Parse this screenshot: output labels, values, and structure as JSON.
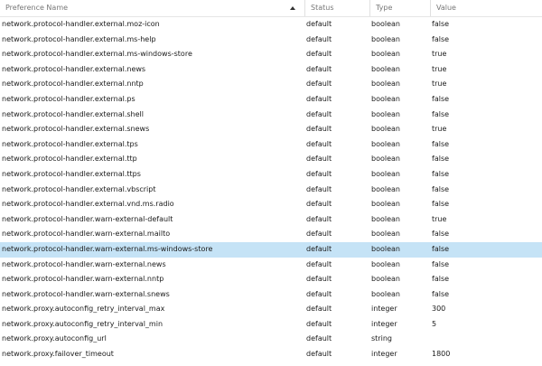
{
  "columns": {
    "name": "Preference Name",
    "status": "Status",
    "type": "Type",
    "value": "Value"
  },
  "sort": {
    "column": "name",
    "direction": "ascending",
    "icon": "sort-ascending-icon"
  },
  "colors": {
    "selected_row": "#c5e3f6"
  },
  "selected_index": 15,
  "rows": [
    {
      "name": "network.protocol-handler.external.moz-icon",
      "status": "default",
      "type": "boolean",
      "value": "false"
    },
    {
      "name": "network.protocol-handler.external.ms-help",
      "status": "default",
      "type": "boolean",
      "value": "false"
    },
    {
      "name": "network.protocol-handler.external.ms-windows-store",
      "status": "default",
      "type": "boolean",
      "value": "true"
    },
    {
      "name": "network.protocol-handler.external.news",
      "status": "default",
      "type": "boolean",
      "value": "true"
    },
    {
      "name": "network.protocol-handler.external.nntp",
      "status": "default",
      "type": "boolean",
      "value": "true"
    },
    {
      "name": "network.protocol-handler.external.ps",
      "status": "default",
      "type": "boolean",
      "value": "false"
    },
    {
      "name": "network.protocol-handler.external.shell",
      "status": "default",
      "type": "boolean",
      "value": "false"
    },
    {
      "name": "network.protocol-handler.external.snews",
      "status": "default",
      "type": "boolean",
      "value": "true"
    },
    {
      "name": "network.protocol-handler.external.tps",
      "status": "default",
      "type": "boolean",
      "value": "false"
    },
    {
      "name": "network.protocol-handler.external.ttp",
      "status": "default",
      "type": "boolean",
      "value": "false"
    },
    {
      "name": "network.protocol-handler.external.ttps",
      "status": "default",
      "type": "boolean",
      "value": "false"
    },
    {
      "name": "network.protocol-handler.external.vbscript",
      "status": "default",
      "type": "boolean",
      "value": "false"
    },
    {
      "name": "network.protocol-handler.external.vnd.ms.radio",
      "status": "default",
      "type": "boolean",
      "value": "false"
    },
    {
      "name": "network.protocol-handler.warn-external-default",
      "status": "default",
      "type": "boolean",
      "value": "true"
    },
    {
      "name": "network.protocol-handler.warn-external.mailto",
      "status": "default",
      "type": "boolean",
      "value": "false"
    },
    {
      "name": "network.protocol-handler.warn-external.ms-windows-store",
      "status": "default",
      "type": "boolean",
      "value": "false"
    },
    {
      "name": "network.protocol-handler.warn-external.news",
      "status": "default",
      "type": "boolean",
      "value": "false"
    },
    {
      "name": "network.protocol-handler.warn-external.nntp",
      "status": "default",
      "type": "boolean",
      "value": "false"
    },
    {
      "name": "network.protocol-handler.warn-external.snews",
      "status": "default",
      "type": "boolean",
      "value": "false"
    },
    {
      "name": "network.proxy.autoconfig_retry_interval_max",
      "status": "default",
      "type": "integer",
      "value": "300"
    },
    {
      "name": "network.proxy.autoconfig_retry_interval_min",
      "status": "default",
      "type": "integer",
      "value": "5"
    },
    {
      "name": "network.proxy.autoconfig_url",
      "status": "default",
      "type": "string",
      "value": ""
    },
    {
      "name": "network.proxy.failover_timeout",
      "status": "default",
      "type": "integer",
      "value": "1800"
    }
  ]
}
